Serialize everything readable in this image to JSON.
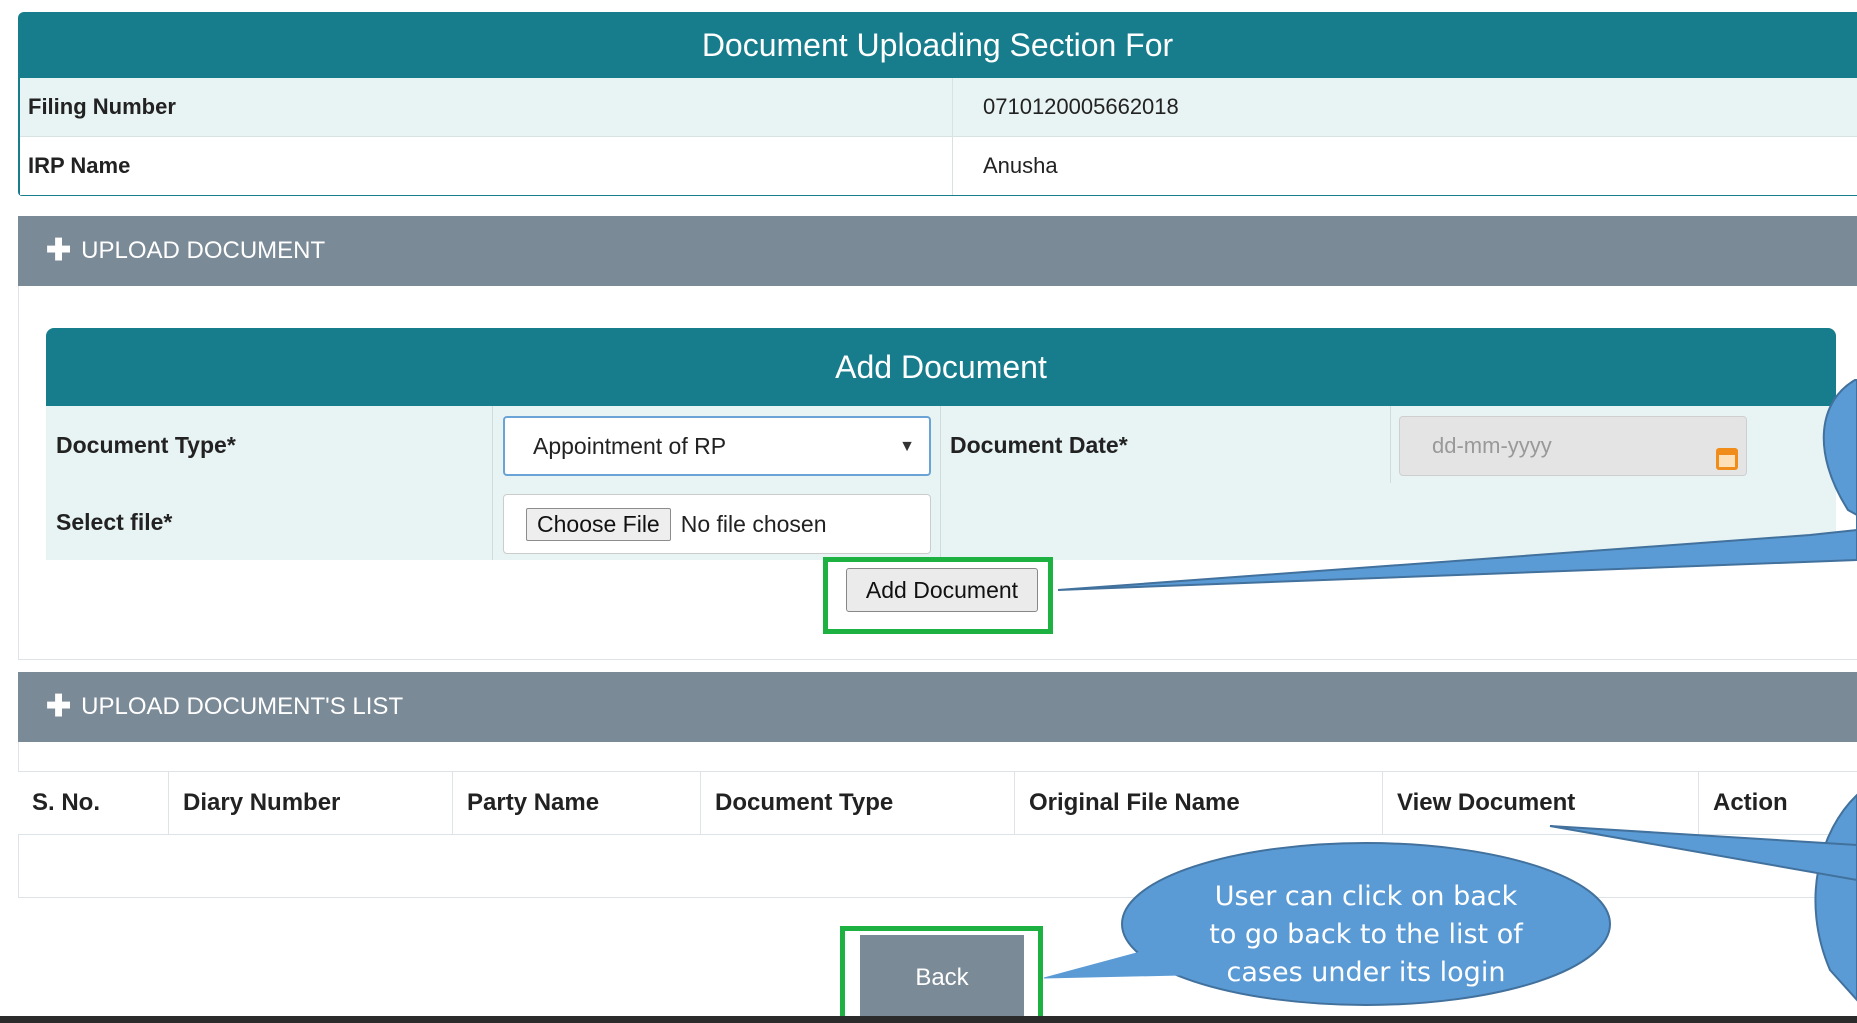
{
  "header": {
    "title": "Document Uploading Section For"
  },
  "info": [
    {
      "label": "Filing Number",
      "value": "0710120005662018"
    },
    {
      "label": "IRP Name",
      "value": "Anusha"
    }
  ],
  "upload_panel": {
    "title": "UPLOAD DOCUMENT"
  },
  "add_document": {
    "title": "Add Document",
    "document_type_label": "Document Type*",
    "document_type_value": "Appointment of RP",
    "document_date_label": "Document Date*",
    "document_date_placeholder": "dd-mm-yyyy",
    "select_file_label": "Select file*",
    "choose_file_button": "Choose File",
    "no_file_text": "No file chosen",
    "add_button": "Add Document"
  },
  "list_panel": {
    "title": "UPLOAD DOCUMENT'S LIST"
  },
  "table": {
    "columns": [
      "S. No.",
      "Diary Number",
      "Party Name",
      "Document Type",
      "Original File Name",
      "View Document",
      "Action"
    ]
  },
  "back_button": "Back",
  "callout": {
    "text_lines": [
      "User can click on back",
      "to go back to the list of",
      "cases under its login"
    ]
  },
  "colors": {
    "teal": "#177d8c",
    "panel_gray": "#7b8a97",
    "highlight_green": "#1db142",
    "callout_blue": "#5b9bd5"
  },
  "icons": {
    "panel_expand": "plus-icon",
    "date_picker": "calendar-icon",
    "select_caret": "chevron-down-icon"
  }
}
